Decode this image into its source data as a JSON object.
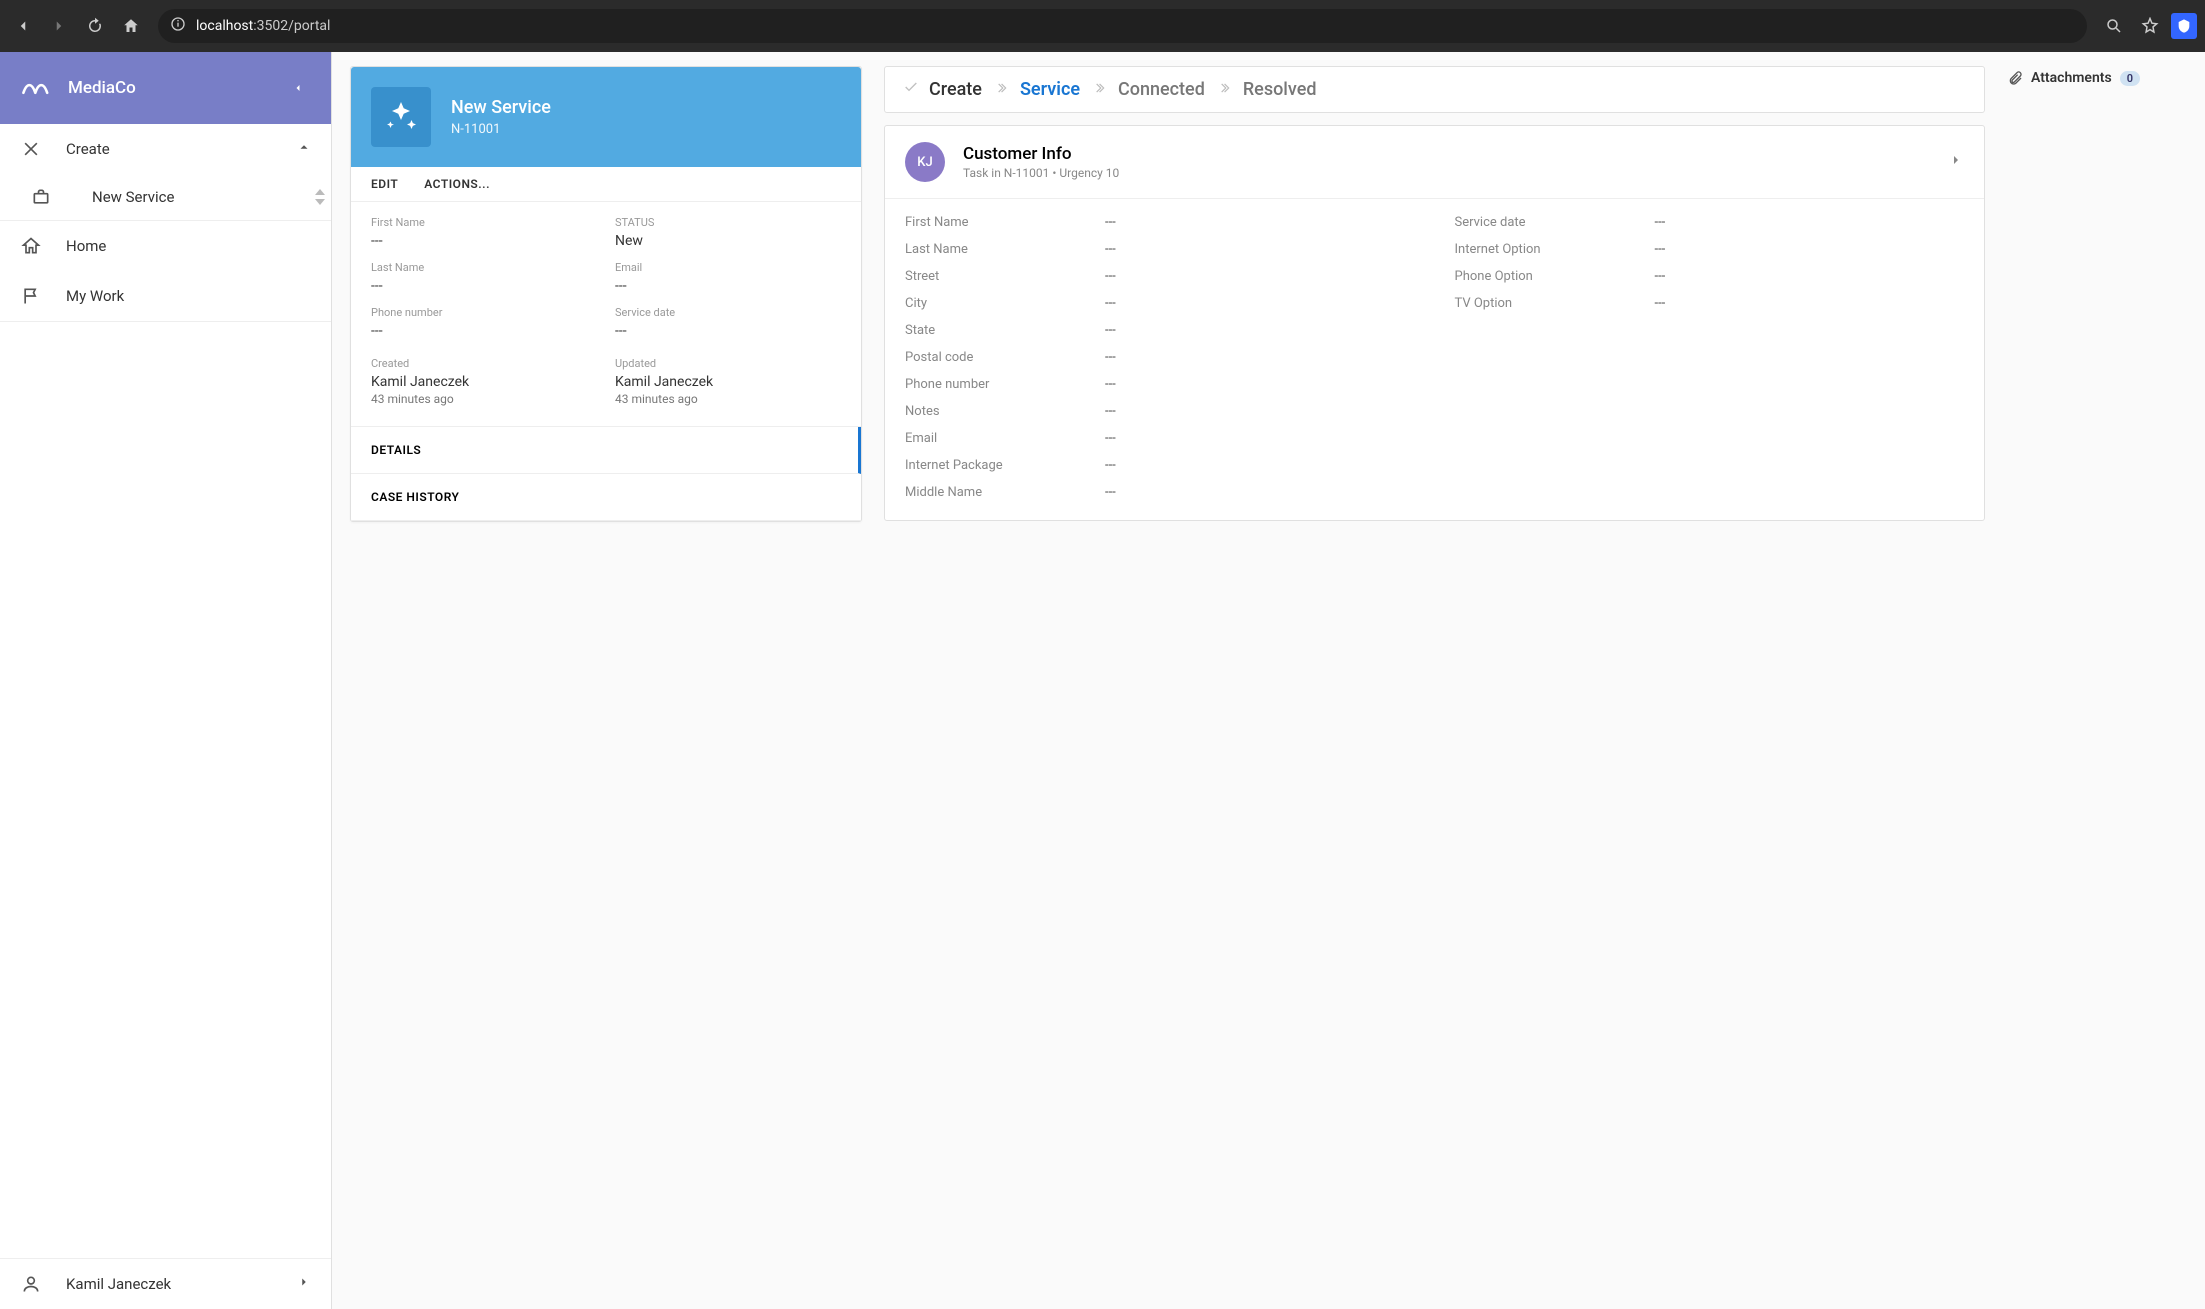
{
  "browser": {
    "url_host": "localhost",
    "url_rest": ":3502/portal"
  },
  "sidebar": {
    "brand": "MediaCo",
    "create_label": "Create",
    "items": [
      {
        "label": "New Service",
        "icon": "briefcase"
      }
    ],
    "nav": [
      {
        "label": "Home",
        "icon": "home"
      },
      {
        "label": "My Work",
        "icon": "flag"
      }
    ],
    "footer_user": "Kamil Janeczek"
  },
  "caseCard": {
    "title": "New Service",
    "id": "N-11001",
    "edit_label": "EDIT",
    "actions_label": "ACTIONS...",
    "details": [
      {
        "lbl": "First Name",
        "val": "---"
      },
      {
        "lbl": "STATUS",
        "val": "New"
      },
      {
        "lbl": "Last Name",
        "val": "---"
      },
      {
        "lbl": "Email",
        "val": "---"
      },
      {
        "lbl": "Phone number",
        "val": "---"
      },
      {
        "lbl": "Service date",
        "val": "---"
      }
    ],
    "meta": [
      {
        "lbl": "Created",
        "val": "Kamil Janeczek",
        "sub": "43 minutes ago"
      },
      {
        "lbl": "Updated",
        "val": "Kamil Janeczek",
        "sub": "43 minutes ago"
      }
    ],
    "tabs": {
      "details": "DETAILS",
      "history": "CASE HISTORY"
    }
  },
  "stages": {
    "s1": "Create",
    "s2": "Service",
    "s3": "Connected",
    "s4": "Resolved"
  },
  "task": {
    "avatar_initials": "KJ",
    "title": "Customer Info",
    "subtitle": "Task in N-11001 • Urgency 10",
    "left_fields": [
      {
        "lbl": "First Name",
        "val": "---"
      },
      {
        "lbl": "Last Name",
        "val": "---"
      },
      {
        "lbl": "Street",
        "val": "---"
      },
      {
        "lbl": "City",
        "val": "---"
      },
      {
        "lbl": "State",
        "val": "---"
      },
      {
        "lbl": "Postal code",
        "val": "---"
      },
      {
        "lbl": "Phone number",
        "val": "---"
      },
      {
        "lbl": "Notes",
        "val": "---"
      },
      {
        "lbl": "Email",
        "val": "---"
      },
      {
        "lbl": "Internet Package",
        "val": "---"
      },
      {
        "lbl": "Middle Name",
        "val": "---"
      }
    ],
    "right_fields": [
      {
        "lbl": "Service date",
        "val": "---"
      },
      {
        "lbl": "Internet Option",
        "val": "---"
      },
      {
        "lbl": "Phone Option",
        "val": "---"
      },
      {
        "lbl": "TV Option",
        "val": "---"
      }
    ]
  },
  "rail": {
    "attachments_label": "Attachments",
    "attachments_count": "0"
  }
}
